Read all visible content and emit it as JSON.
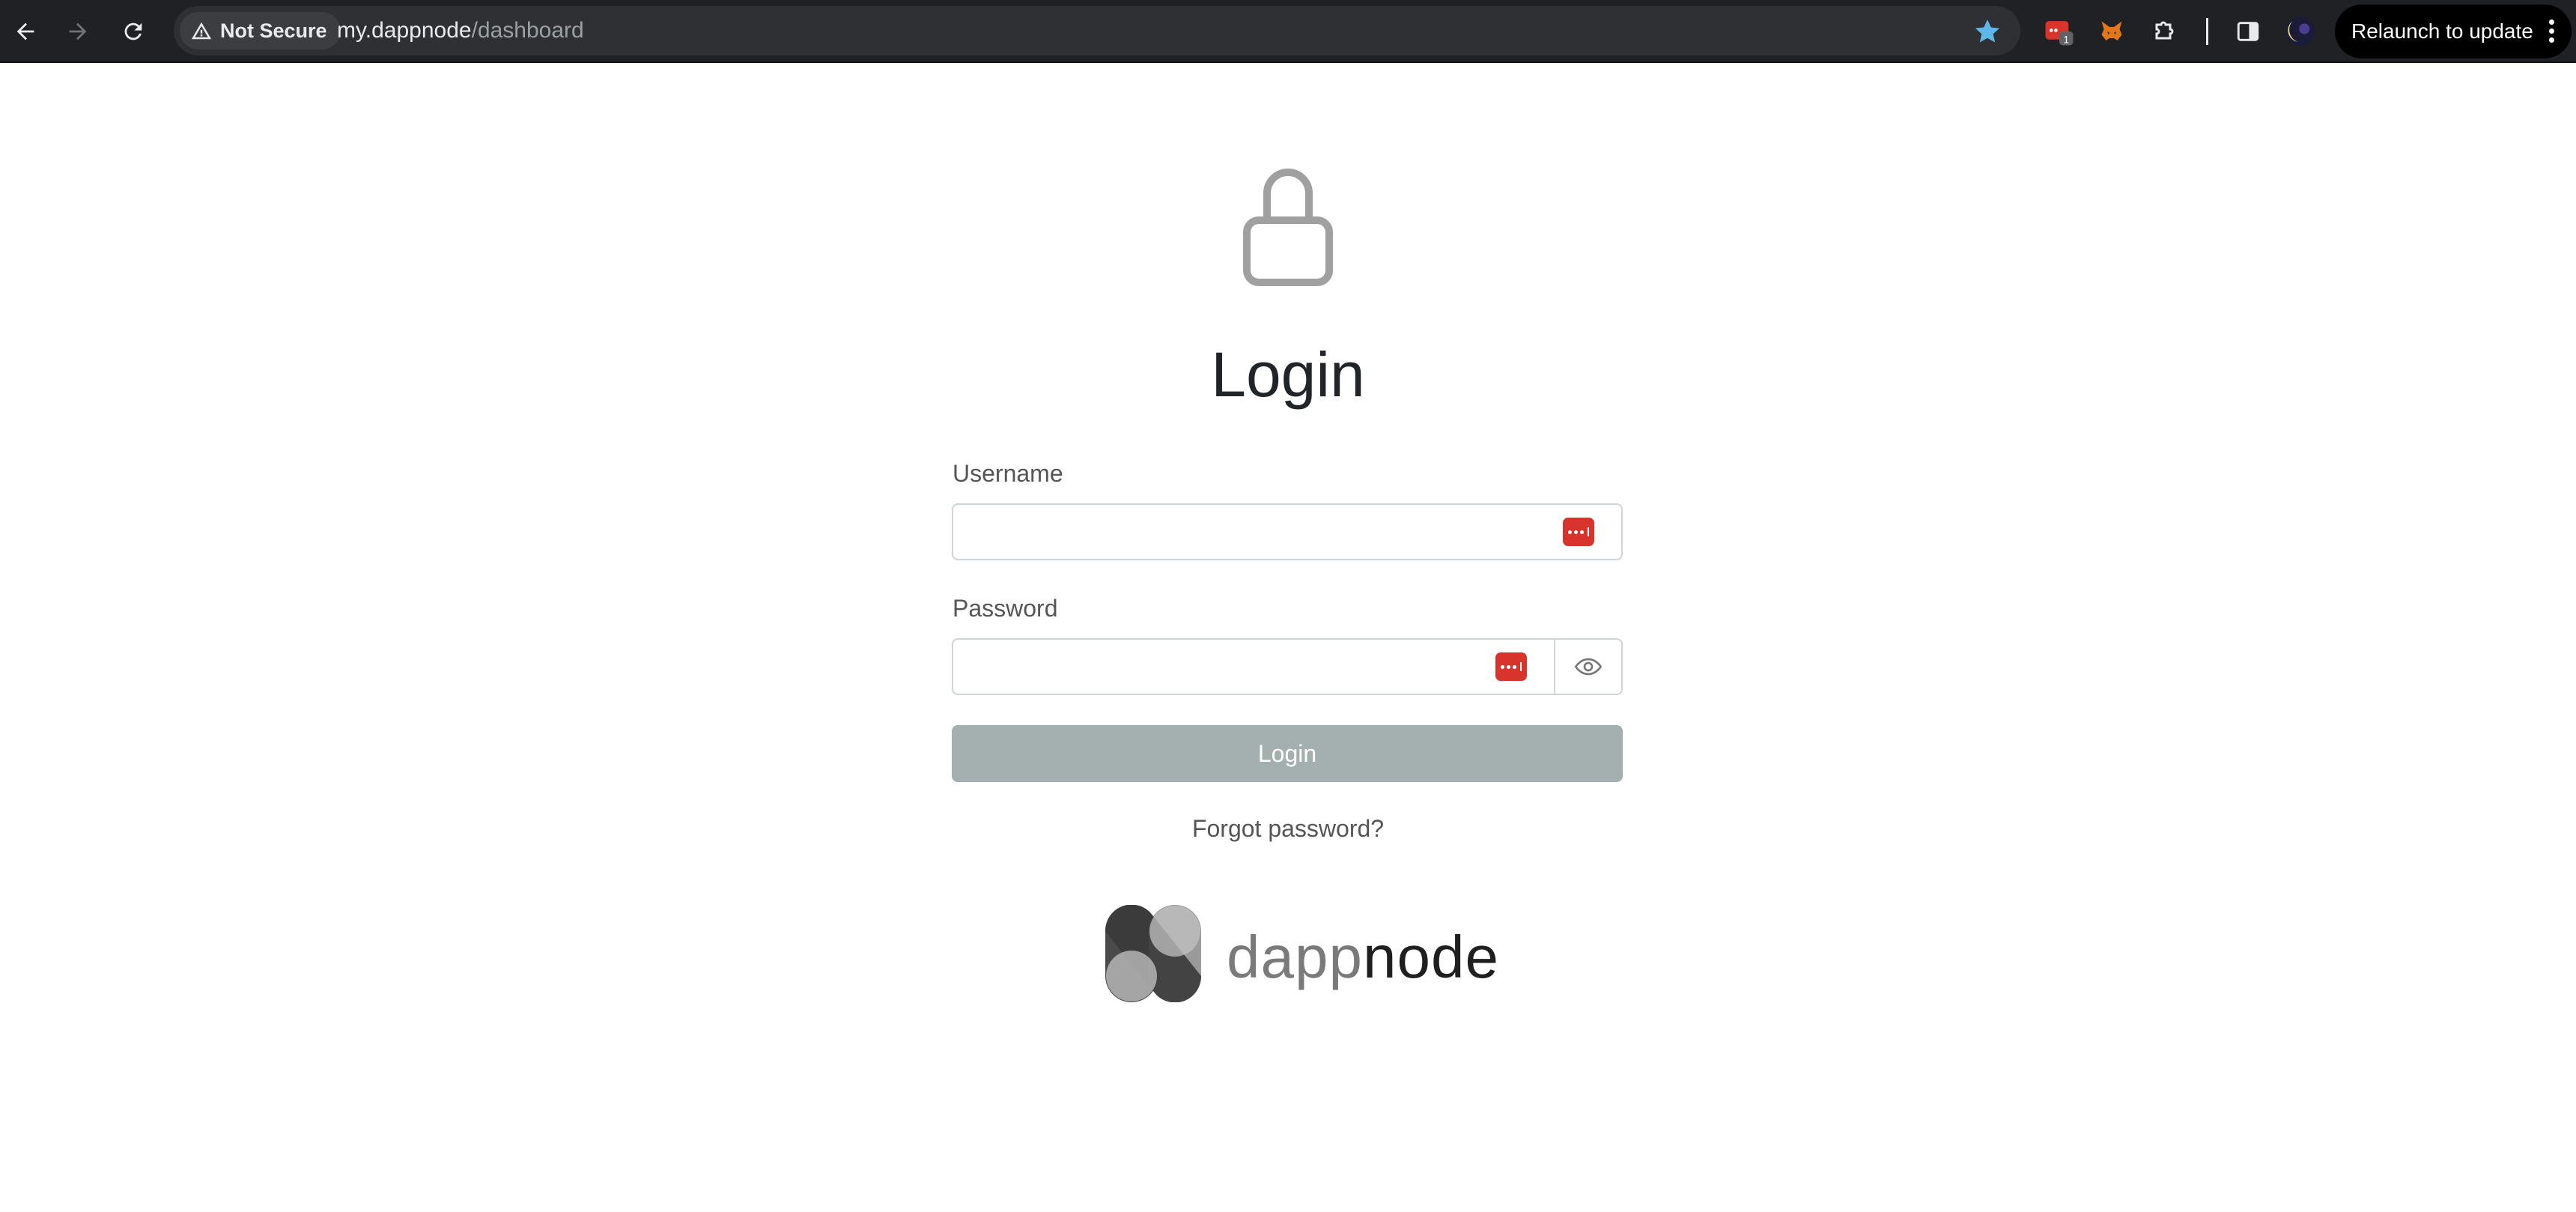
{
  "browser": {
    "security_chip": "Not Secure",
    "url_host": "my.dappnode",
    "url_path": "/dashboard",
    "extension_badge": "1",
    "relaunch_label": "Relaunch to update"
  },
  "icons": [
    "back-arrow-icon",
    "forward-arrow-icon",
    "reload-icon",
    "warning-icon",
    "bookmark-star-icon",
    "extension-icon",
    "metamask-fox-icon",
    "puzzle-icon",
    "side-panel-icon",
    "profile-avatar-icon",
    "menu-dots-icon",
    "lock-icon",
    "password-manager-icon",
    "eye-icon",
    "dappnode-logo-icon"
  ],
  "colors": {
    "chrome_bg": "#202124",
    "login_button": "#a4b0b0",
    "password_manager": "#d9342b",
    "star": "#5fb7e8"
  },
  "login": {
    "title": "Login",
    "username_label": "Username",
    "username_value": "",
    "password_label": "Password",
    "password_value": "",
    "submit_label": "Login",
    "forgot_label": "Forgot password?"
  },
  "brand": {
    "name_part1": "dapp",
    "name_part2": "node"
  }
}
